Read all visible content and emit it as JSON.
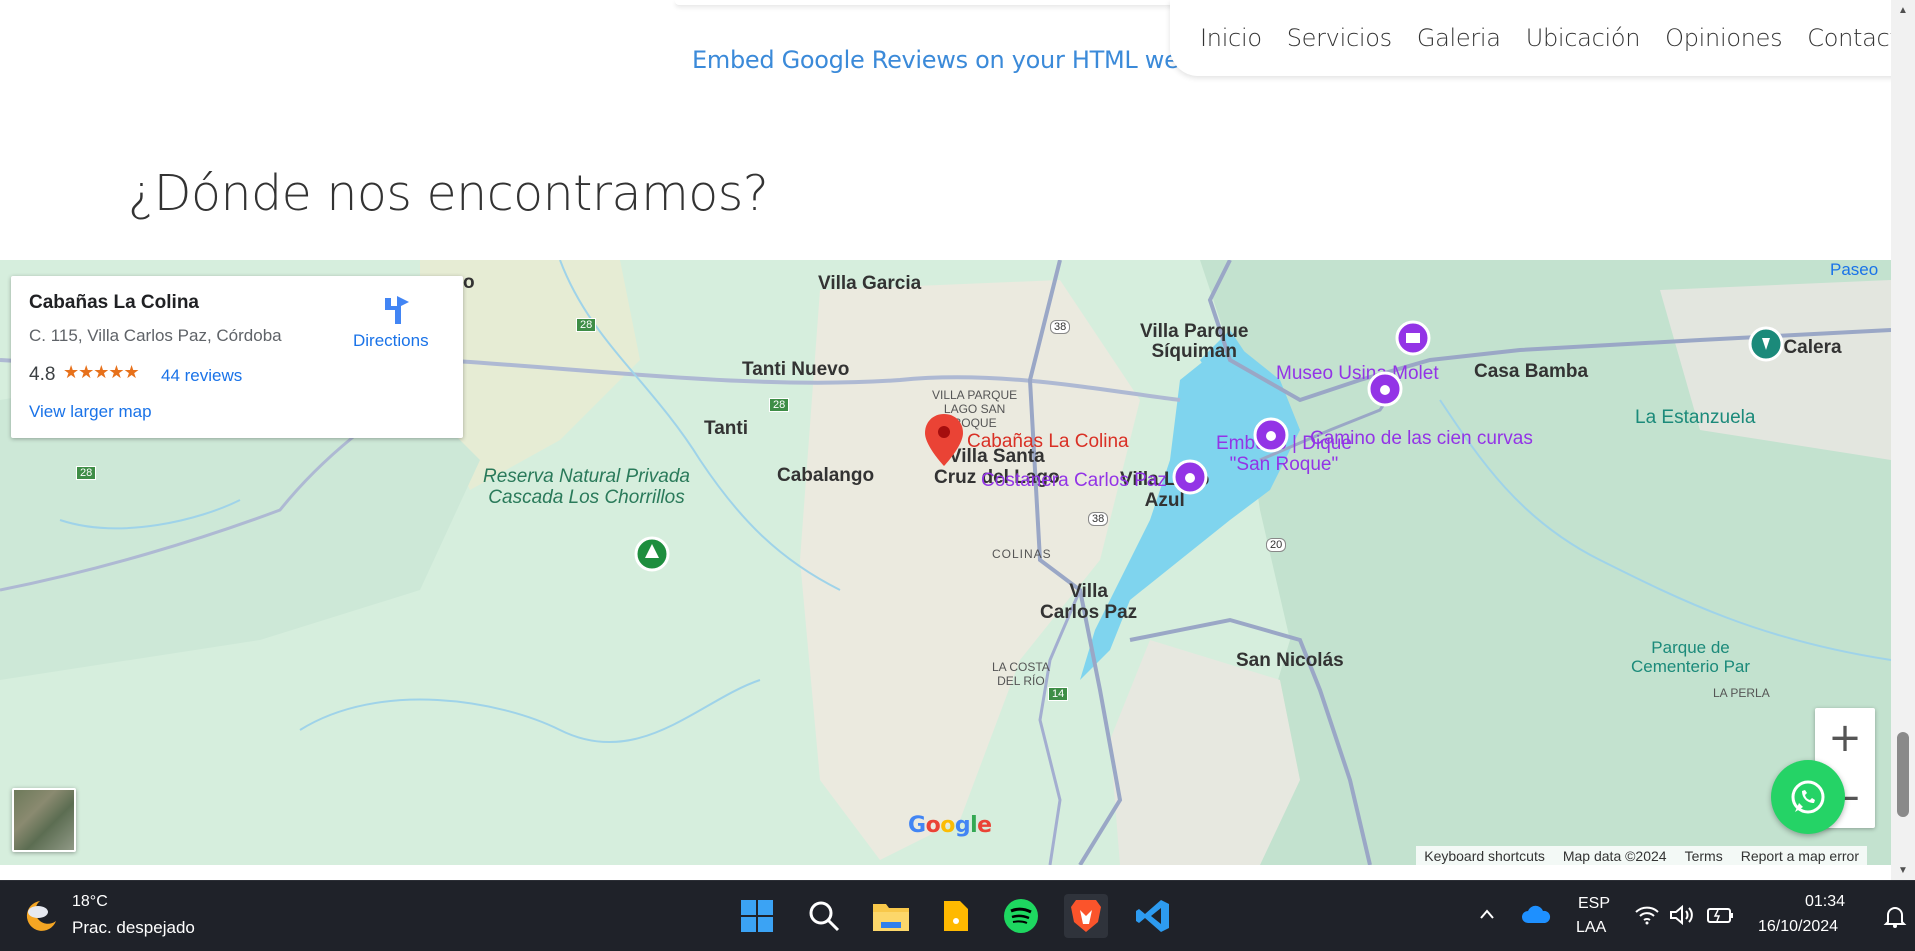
{
  "header": {
    "embed_link": "Embed Google Reviews on your HTML website",
    "nav": [
      "Inicio",
      "Servicios",
      "Galeria",
      "Ubicación",
      "Opiniones",
      "Contacto"
    ]
  },
  "section": {
    "title": "¿Dónde nos encontramos?"
  },
  "map": {
    "card": {
      "name": "Cabañas La Colina",
      "address": "C. 115, Villa Carlos Paz, Córdoba",
      "rating": "4.8",
      "stars": "★★★★★",
      "reviews": "44 reviews",
      "larger_map": "View larger map",
      "directions": "Directions"
    },
    "labels": {
      "villa_garcia": "Villa Garcia",
      "tanti_nuevo": "Tanti Nuevo",
      "tanti": "Tanti",
      "villa_parque_lago1": "VILLA PARQUE",
      "villa_parque_lago2": "LAGO SAN",
      "villa_parque_lago3": "ROQUE",
      "villa_parque_siquiman1": "Villa Parque",
      "villa_parque_siquiman2": "Síquiman",
      "museo": "Museo Usina Molet",
      "casa_bamba": "Casa Bamba",
      "la_calera": "La Calera",
      "la_estanzuela": "La Estanzuela",
      "paseo": "Paseo",
      "villa_santa1": "Villa Santa",
      "villa_santa2": "Cruz del Lago",
      "villa_lago1": "Villa Lago",
      "villa_lago2": "Azul",
      "embudo1": "Embudo | Dique",
      "embudo2": "\"San Roque\"",
      "reserva1": "Reserva Natural Privada",
      "reserva2": "Cascada Los Chorrillos",
      "pin_label": "Cabañas La Colina",
      "camino": "Camino de las cien curvas",
      "cabalango": "Cabalango",
      "costanera": "Costanera Carlos Paz",
      "colinas": "COLINAS",
      "villa_carlos1": "Villa",
      "villa_carlos2": "Carlos Paz",
      "san_nicolas": "San Nicolás",
      "la_costa1": "LA COSTA",
      "la_costa2": "DEL RÍO",
      "parque_cem1": "Parque de",
      "parque_cem2": "Cementerio Par",
      "la_perla": "LA PERLA",
      "partial_o": "o"
    },
    "routes": [
      "28",
      "28",
      "28",
      "28",
      "38",
      "38",
      "20",
      "14"
    ],
    "google_logo": "Google",
    "attribution": {
      "shortcuts": "Keyboard shortcuts",
      "data": "Map data ©2024",
      "terms": "Terms",
      "report": "Report a map error"
    },
    "zoom_in": "+",
    "zoom_out": "−"
  },
  "taskbar": {
    "temp": "18°C",
    "weather": "Prac. despejado",
    "lang1": "ESP",
    "lang2": "LAA",
    "time": "01:34",
    "date": "16/10/2024"
  },
  "colors": {
    "link": "#1a73e8",
    "accent_link": "#3b8ad9",
    "lake": "#7fd4ee",
    "poi_purple": "#9334e6",
    "pin_red": "#ea4335",
    "whatsapp": "#25d366"
  }
}
